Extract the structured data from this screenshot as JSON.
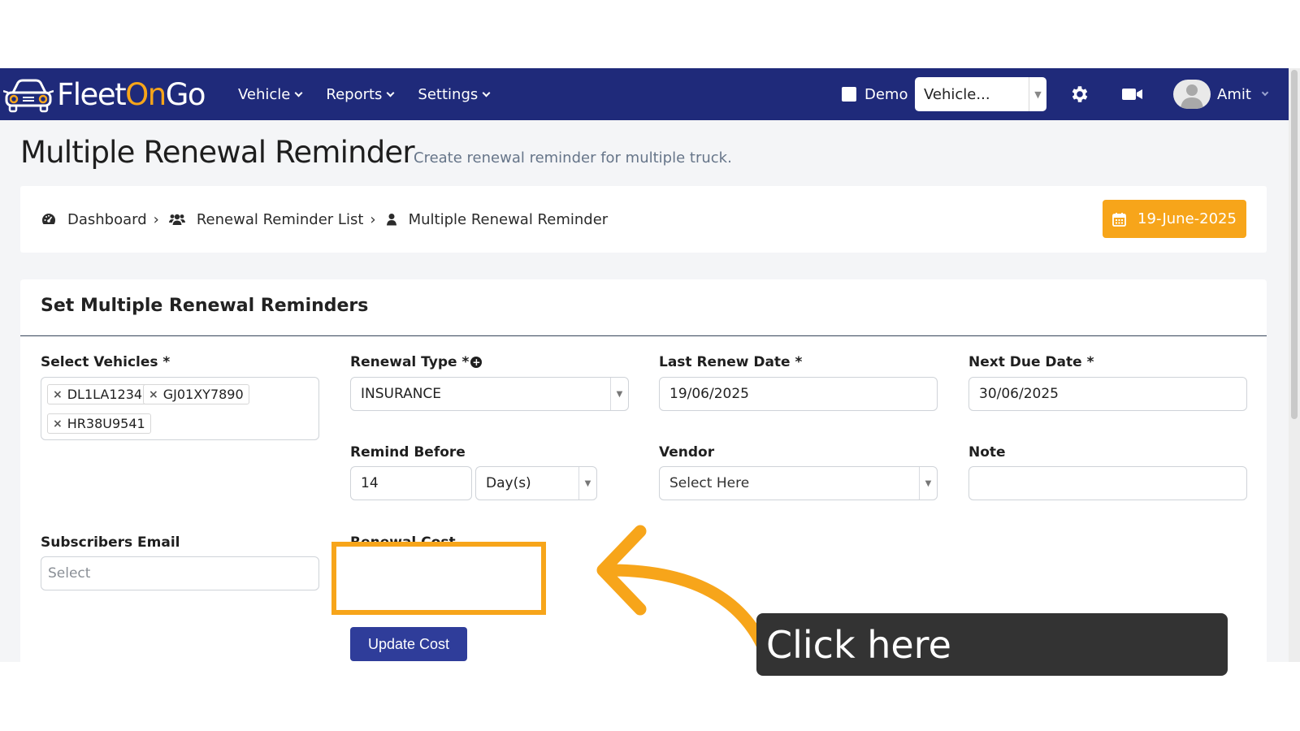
{
  "app": {
    "logo": {
      "fleet": "Fleet",
      "on": "On",
      "go": "Go"
    },
    "nav": [
      {
        "label": "Vehicle"
      },
      {
        "label": "Reports"
      },
      {
        "label": "Settings"
      }
    ],
    "demo_label": "Demo",
    "vehicle_select": "Vehicle...",
    "user_name": "Amit"
  },
  "page": {
    "title": "Multiple Renewal Reminder",
    "subtitle": "Create renewal reminder for multiple truck."
  },
  "breadcrumb": {
    "items": [
      "Dashboard",
      "Renewal Reminder List",
      "Multiple Renewal Reminder"
    ],
    "separator": "›",
    "date": "19-June-2025"
  },
  "form": {
    "card_title": "Set Multiple Renewal Reminders",
    "select_vehicles": {
      "label": "Select Vehicles *",
      "tags": [
        "DL1LA1234",
        "GJ01XY7890",
        "HR38U9541"
      ]
    },
    "renewal_type": {
      "label": "Renewal Type *",
      "value": "INSURANCE"
    },
    "last_renew_date": {
      "label": "Last Renew Date *",
      "value": "19/06/2025"
    },
    "next_due_date": {
      "label": "Next Due Date *",
      "value": "30/06/2025"
    },
    "remind_before": {
      "label": "Remind Before",
      "value": "14",
      "unit": "Day(s)"
    },
    "vendor": {
      "label": "Vendor",
      "placeholder": "Select Here"
    },
    "note": {
      "label": "Note",
      "value": ""
    },
    "subscribers_email": {
      "label": "Subscribers Email",
      "placeholder": "Select"
    },
    "renewal_cost": {
      "label": "Renewal Cost",
      "button": "Update Cost"
    }
  },
  "annotation": {
    "callout": "Click here",
    "accent": "#f7a51a"
  },
  "colors": {
    "navbar": "#1f2a7a",
    "primary_button": "#2f3d9a",
    "badge": "#f7a51a"
  }
}
